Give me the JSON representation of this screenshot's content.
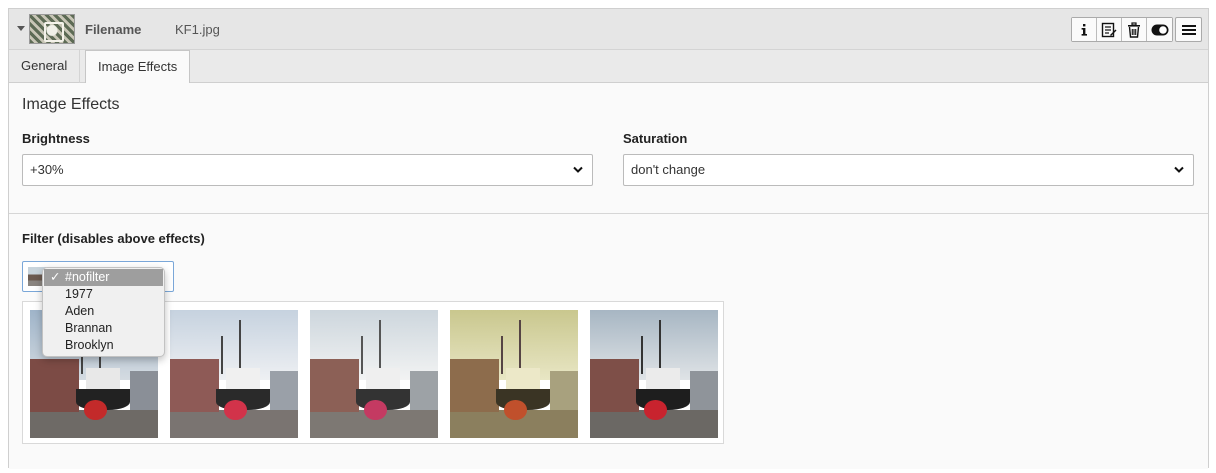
{
  "header": {
    "filename_label": "Filename",
    "filename_value": "KF1.jpg",
    "buttons": [
      "info-icon",
      "edit-icon",
      "delete-icon",
      "toggle-icon"
    ],
    "menu_icon": "menu-icon",
    "thumbnail_icon": "image-thumbnail"
  },
  "tabs": [
    {
      "label": "General",
      "active": false
    },
    {
      "label": "Image Effects",
      "active": true
    }
  ],
  "image_effects": {
    "title": "Image Effects",
    "brightness": {
      "label": "Brightness",
      "value": "+30%"
    },
    "saturation": {
      "label": "Saturation",
      "value": "don't change"
    }
  },
  "filter": {
    "label": "Filter (disables above effects)",
    "options": [
      "#nofilter",
      "1977",
      "Aden",
      "Brannan",
      "Brooklyn"
    ],
    "selected": "#nofilter",
    "check_glyph": "✓"
  },
  "gallery": {
    "count": 5,
    "colors": {
      "normal_sky": "#b9c6d2",
      "warm_sky": "#d9dcc0",
      "warm_tint": "#c9c78e",
      "hull_red": "#c32a2a"
    }
  }
}
